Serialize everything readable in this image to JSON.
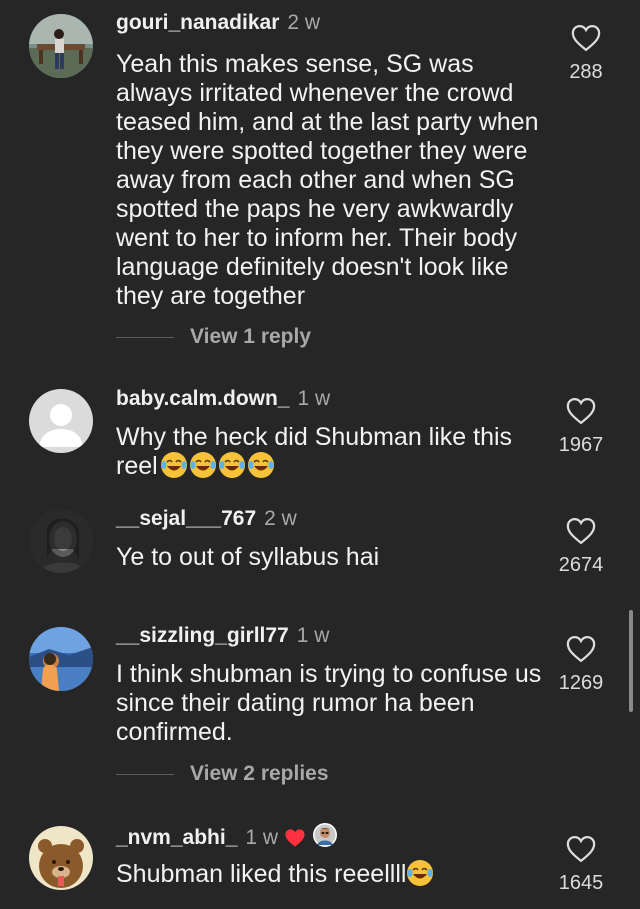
{
  "comments": [
    {
      "username": "gouri_nanadikar",
      "time": "2 w",
      "text": "Yeah this makes sense, SG was always irritated whenever the crowd teased him, and at the last party when they were spotted together they were away from each other and when SG spotted the paps he very awkwardly went to her to inform her. Their body language definitely doesn't look like they are together",
      "likes": "288",
      "view_replies": "View 1 reply"
    },
    {
      "username": "baby.calm.down_",
      "time": "1 w",
      "text": "Why the heck did Shubman like this reel",
      "emoji_count": 4,
      "likes": "1967"
    },
    {
      "username": "__sejal___767",
      "time": "2 w",
      "text": "Ye to out of syllabus hai",
      "likes": "2674"
    },
    {
      "username": "__sizzling_girll77",
      "time": "1 w",
      "text": "I think shubman is trying to confuse us since their dating rumor ha been confirmed.",
      "likes": "1269",
      "view_replies": "View 2 replies"
    },
    {
      "username": "_nvm_abhi_",
      "time": "1 w",
      "text": "Shubman liked this reeellll",
      "emoji_count": 1,
      "likes": "1645"
    }
  ],
  "icons": {
    "like": "heart-outline-icon",
    "liked_by_creator": "red-heart-icon",
    "emoji": "face-with-tears-of-joy"
  },
  "colors": {
    "background": "#262626",
    "text": "#f2f2f2",
    "secondary": "#a8a8a8",
    "heart_red": "#ff3040"
  }
}
